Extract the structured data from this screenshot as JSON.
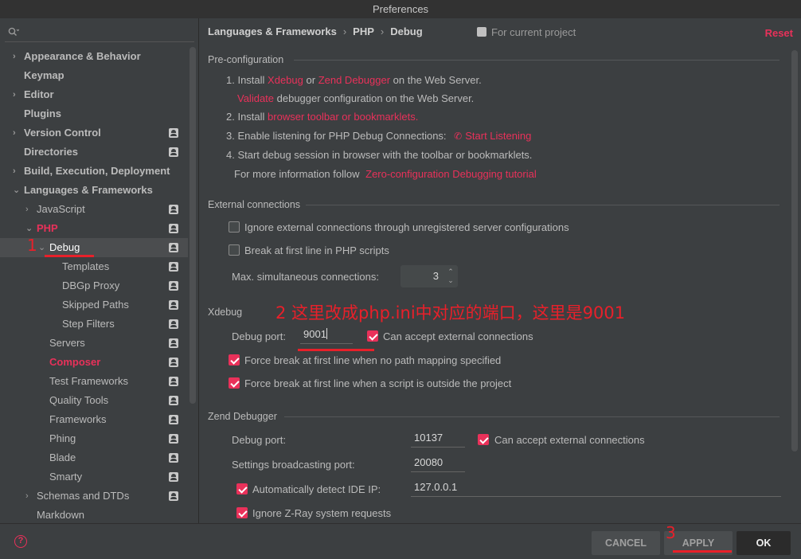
{
  "window": {
    "title": "Preferences"
  },
  "search": {
    "placeholder": "",
    "value": ""
  },
  "tree": {
    "items": [
      {
        "label": "Appearance & Behavior",
        "arrow": "›",
        "style": "bold"
      },
      {
        "label": "Keymap",
        "arrow": "",
        "style": "bold"
      },
      {
        "label": "Editor",
        "arrow": "›",
        "style": "bold"
      },
      {
        "label": "Plugins",
        "arrow": "",
        "style": "bold"
      },
      {
        "label": "Version Control",
        "arrow": "›",
        "style": "bold"
      },
      {
        "label": "Directories",
        "arrow": "",
        "style": "bold"
      },
      {
        "label": "Build, Execution, Deployment",
        "arrow": "›",
        "style": "bold"
      },
      {
        "label": "Languages & Frameworks",
        "arrow": "⌄",
        "style": "bold"
      },
      {
        "label": "JavaScript",
        "arrow": "›",
        "style": "normal"
      },
      {
        "label": "PHP",
        "arrow": "⌄",
        "style": "red"
      },
      {
        "label": "Debug",
        "arrow": "⌄",
        "style": "selected"
      },
      {
        "label": "Templates",
        "arrow": "",
        "style": "normal"
      },
      {
        "label": "DBGp Proxy",
        "arrow": "",
        "style": "normal"
      },
      {
        "label": "Skipped Paths",
        "arrow": "",
        "style": "normal"
      },
      {
        "label": "Step Filters",
        "arrow": "",
        "style": "normal"
      },
      {
        "label": "Servers",
        "arrow": "",
        "style": "normal"
      },
      {
        "label": "Composer",
        "arrow": "",
        "style": "red"
      },
      {
        "label": "Test Frameworks",
        "arrow": "",
        "style": "normal"
      },
      {
        "label": "Quality Tools",
        "arrow": "",
        "style": "normal"
      },
      {
        "label": "Frameworks",
        "arrow": "",
        "style": "normal"
      },
      {
        "label": "Phing",
        "arrow": "",
        "style": "normal"
      },
      {
        "label": "Blade",
        "arrow": "",
        "style": "normal"
      },
      {
        "label": "Smarty",
        "arrow": "",
        "style": "normal"
      },
      {
        "label": "Schemas and DTDs",
        "arrow": "›",
        "style": "normal"
      },
      {
        "label": "Markdown",
        "arrow": "",
        "style": "normal"
      }
    ]
  },
  "annotations": {
    "one": "1",
    "two": "2 这里改成php.ini中对应的端口，这里是9001",
    "three": "3"
  },
  "header": {
    "crumb1": "Languages & Frameworks",
    "crumb2": "PHP",
    "crumb3": "Debug",
    "sep": "›",
    "for_project": "For current project",
    "reset": "Reset"
  },
  "preconfig": {
    "title": "Pre-configuration",
    "l1a": "1. Install",
    "xdebug": "Xdebug",
    "or": "or",
    "zend_debugger": "Zend Debugger",
    "l1b": "on the Web Server.",
    "validate": "Validate",
    "l1c": "debugger configuration on the Web Server.",
    "l2a": "2. Install",
    "toolbar_link": "browser toolbar or bookmarklets.",
    "l3a": "3. Enable listening for PHP Debug Connections:",
    "start_listening": "Start Listening",
    "l4": "4. Start debug session in browser with the toolbar or bookmarklets.",
    "more_info": "For more information follow",
    "tutorial": "Zero-configuration Debugging tutorial"
  },
  "external": {
    "title": "External connections",
    "ignore": "Ignore external connections through unregistered server configurations",
    "break_first": "Break at first line in PHP scripts",
    "max_label": "Max. simultaneous connections:",
    "max_value": "3"
  },
  "xdebug": {
    "title": "Xdebug",
    "port_label": "Debug port:",
    "port_value": "9001",
    "accept": "Can accept external connections",
    "force1": "Force break at first line when no path mapping specified",
    "force2": "Force break at first line when a script is outside the project"
  },
  "zend": {
    "title": "Zend Debugger",
    "port_label": "Debug port:",
    "port_value": "10137",
    "accept": "Can accept external connections",
    "broadcast_label": "Settings broadcasting port:",
    "broadcast_value": "20080",
    "auto_detect": "Automatically detect IDE IP:",
    "ide_ip": "127.0.0.1",
    "ignore_zray": "Ignore Z-Ray system requests"
  },
  "footer": {
    "help": "?",
    "cancel": "CANCEL",
    "apply": "APPLY",
    "ok": "OK"
  },
  "colors": {
    "accent": "#e9315a",
    "annotation": "#e8202a",
    "background": "#3c3f41"
  }
}
